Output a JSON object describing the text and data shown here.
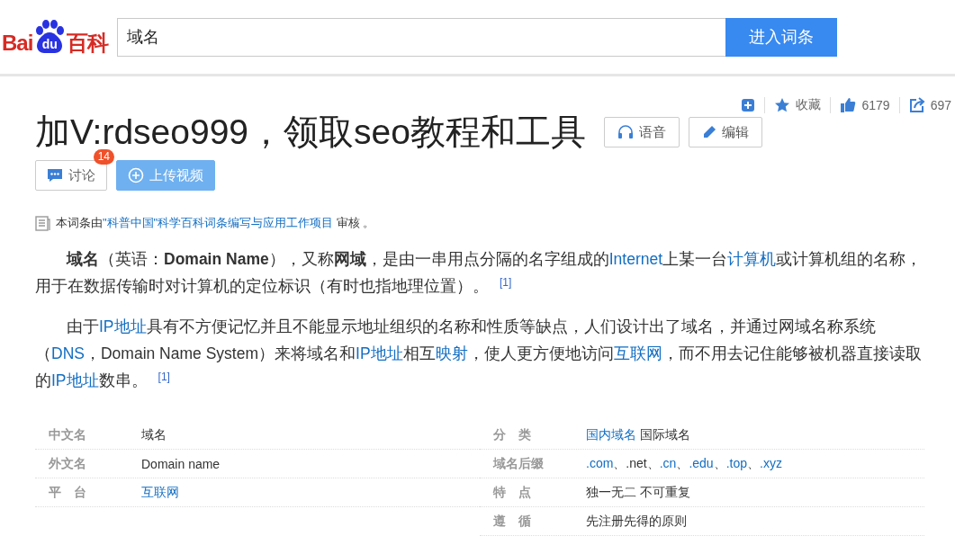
{
  "logo": {
    "parts": [
      "Bai",
      "du",
      "百科"
    ]
  },
  "search": {
    "value": "域名",
    "button": "进入词条"
  },
  "toolbar": [
    {
      "kind": "add"
    },
    {
      "kind": "star",
      "label": "收藏"
    },
    {
      "kind": "like",
      "label": "6179"
    },
    {
      "kind": "share",
      "label": "697"
    }
  ],
  "title": "加V:rdseo999，领取seo教程和工具",
  "title_buttons": [
    {
      "kind": "audio",
      "label": "语音"
    },
    {
      "kind": "edit",
      "label": "编辑"
    }
  ],
  "actions": [
    {
      "kind": "discuss",
      "label": "讨论",
      "badge": "14"
    },
    {
      "kind": "upload",
      "label": "上传视频"
    }
  ],
  "audit": [
    {
      "text": "本词条由",
      "link": false
    },
    {
      "text": "\"科普中国\"科学百科词条编写与应用工作项目",
      "link": true
    },
    {
      "text": " 审核 。",
      "link": false
    }
  ],
  "paragraphs": [
    [
      {
        "text": "域名",
        "kind": "bold"
      },
      {
        "text": "（英语：",
        "kind": "plain"
      },
      {
        "text": "Domain Name",
        "kind": "bold"
      },
      {
        "text": "），又称",
        "kind": "plain"
      },
      {
        "text": "网域",
        "kind": "bold"
      },
      {
        "text": "，是由一串用点分隔的名字组成的",
        "kind": "plain"
      },
      {
        "text": "Internet",
        "kind": "link"
      },
      {
        "text": "上某一台",
        "kind": "plain"
      },
      {
        "text": "计算机",
        "kind": "link"
      },
      {
        "text": "或计算机组的名称，用于在数据传输时对计算机的定位标识（有时也指地理位置）。",
        "kind": "plain"
      },
      {
        "text": "[1]",
        "kind": "ref"
      }
    ],
    [
      {
        "text": "由于",
        "kind": "plain"
      },
      {
        "text": "IP地址",
        "kind": "link"
      },
      {
        "text": "具有不方便记忆并且不能显示地址组织的名称和性质等缺点，人们设计出了域名，并通过网域名称系统（",
        "kind": "plain"
      },
      {
        "text": "DNS",
        "kind": "link"
      },
      {
        "text": "，Domain Name System）来将域名和",
        "kind": "plain"
      },
      {
        "text": "IP地址",
        "kind": "link"
      },
      {
        "text": "相互",
        "kind": "plain"
      },
      {
        "text": "映射",
        "kind": "link"
      },
      {
        "text": "，使人更方便地访问",
        "kind": "plain"
      },
      {
        "text": "互联网",
        "kind": "link"
      },
      {
        "text": "，而不用去记住能够被机器直接读取的",
        "kind": "plain"
      },
      {
        "text": "IP地址",
        "kind": "link"
      },
      {
        "text": "数串。",
        "kind": "plain"
      },
      {
        "text": "[1]",
        "kind": "ref"
      }
    ]
  ],
  "infobox": {
    "left": [
      {
        "label": "中文名",
        "value": [
          {
            "text": "域名",
            "link": false
          }
        ]
      },
      {
        "label": "外文名",
        "value": [
          {
            "text": "Domain name",
            "link": false
          }
        ]
      },
      {
        "label": "平　台",
        "value": [
          {
            "text": "互联网",
            "link": true
          }
        ]
      }
    ],
    "right": [
      {
        "label": "分　类",
        "value": [
          {
            "text": "国内域名",
            "link": true
          },
          {
            "text": " 国际域名",
            "link": false
          }
        ]
      },
      {
        "label": "域名后缀",
        "value": [
          {
            "text": ".com",
            "link": true
          },
          {
            "text": "、",
            "link": false
          },
          {
            "text": ".net",
            "link": false
          },
          {
            "text": "、",
            "link": false
          },
          {
            "text": ".cn",
            "link": true
          },
          {
            "text": "、",
            "link": false
          },
          {
            "text": ".edu",
            "link": true
          },
          {
            "text": "、",
            "link": false
          },
          {
            "text": ".top",
            "link": true
          },
          {
            "text": "、",
            "link": false
          },
          {
            "text": ".xyz",
            "link": true
          }
        ]
      },
      {
        "label": "特　点",
        "value": [
          {
            "text": "独一无二 不可重复",
            "link": false
          }
        ]
      },
      {
        "label": "遵　循",
        "value": [
          {
            "text": "先注册先得的原则",
            "link": false
          }
        ]
      }
    ]
  }
}
